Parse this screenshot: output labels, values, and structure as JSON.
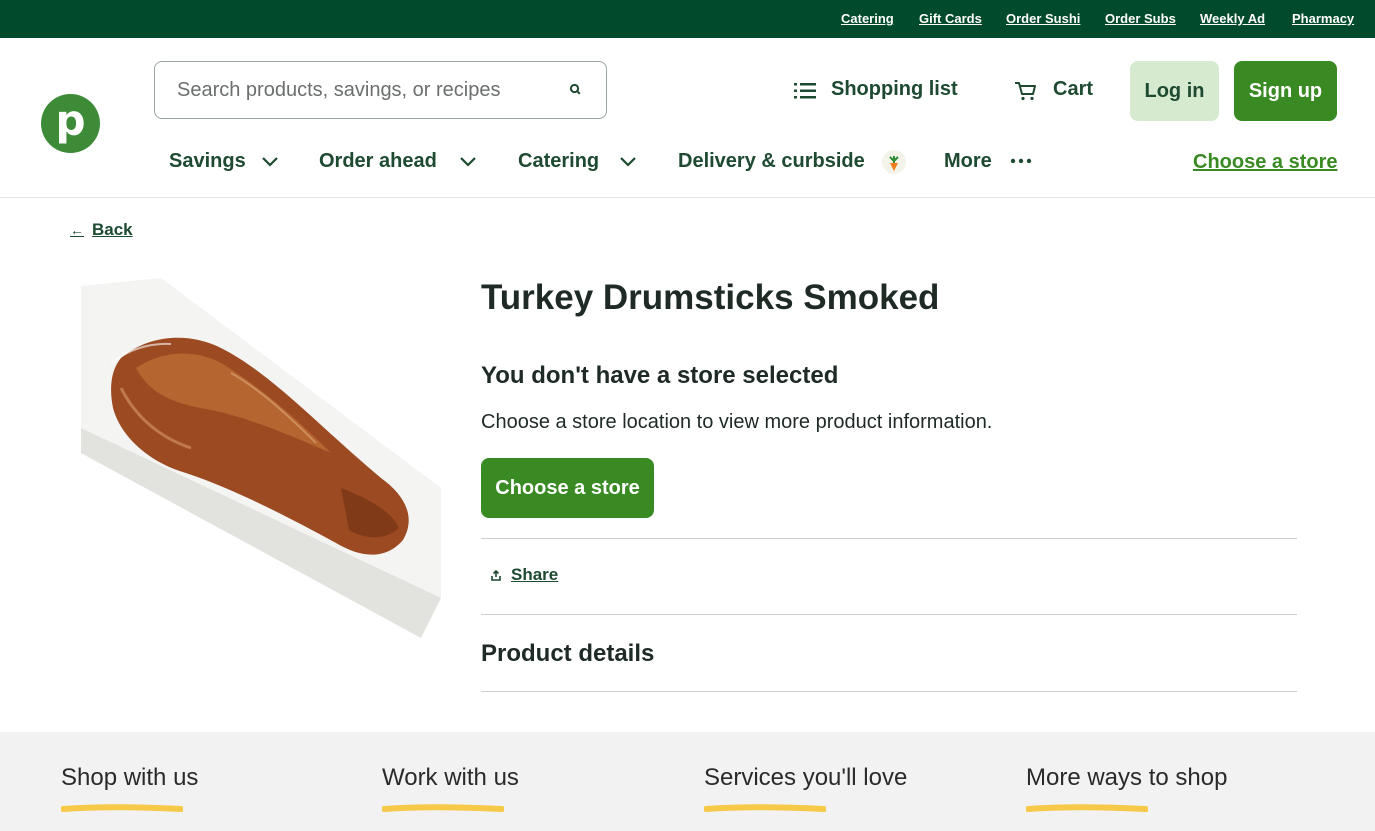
{
  "utility_nav": [
    "Catering",
    "Gift Cards",
    "Order Sushi",
    "Order Subs",
    "Weekly Ad",
    "Pharmacy"
  ],
  "logo": {
    "letter": "p",
    "color": "#3d8b37"
  },
  "search": {
    "placeholder": "Search products, savings, or recipes"
  },
  "header": {
    "shopping_list": "Shopping list",
    "cart": "Cart",
    "login": "Log in",
    "signup": "Sign up"
  },
  "nav": {
    "items": [
      "Savings",
      "Order ahead",
      "Catering",
      "Delivery & curbside",
      "More"
    ],
    "choose_store": "Choose a store"
  },
  "main": {
    "back": "Back",
    "title": "Turkey Drumsticks Smoked",
    "no_store_heading": "You don't have a store selected",
    "no_store_desc": "Choose a store location to view more product information.",
    "choose_store_button": "Choose a store",
    "share": "Share",
    "product_details": "Product details"
  },
  "footer": {
    "columns": [
      "Shop with us",
      "Work with us",
      "Services you'll love",
      "More ways to shop"
    ]
  },
  "colors": {
    "brand_green": "#3a8a24",
    "dark_green": "#024a2c",
    "login_bg": "#d6ead0",
    "underline_yellow": "#f7c948"
  }
}
